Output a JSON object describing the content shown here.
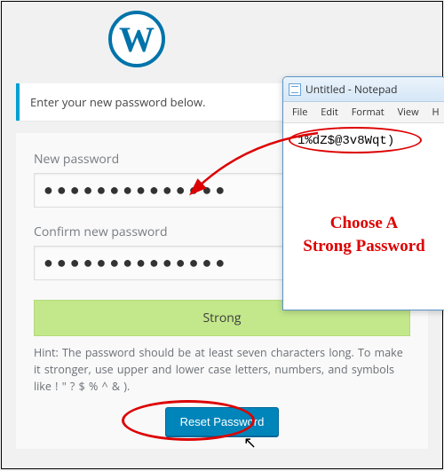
{
  "logo_letter": "W",
  "notice_text": "Enter your new password below.",
  "form": {
    "new_password_label": "New password",
    "new_password_value": "●●●●●●●●●●●●●●",
    "confirm_password_label": "Confirm new password",
    "confirm_password_value": "●●●●●●●●●●●●●●",
    "strength_label": "Strong",
    "hint_text": "Hint: The password should be at least seven characters long. To make it stronger, use upper and lower case letters, numbers, and symbols like ! \" ? $ % ^ & ).",
    "reset_button_label": "Reset Password"
  },
  "notepad": {
    "title": "Untitled - Notepad",
    "menu": {
      "file": "File",
      "edit": "Edit",
      "format": "Format",
      "view": "View",
      "help": "H"
    },
    "sample_password": "1%dZ$@3v8Wqt)"
  },
  "caption_line1": "Choose A",
  "caption_line2": "Strong Password"
}
